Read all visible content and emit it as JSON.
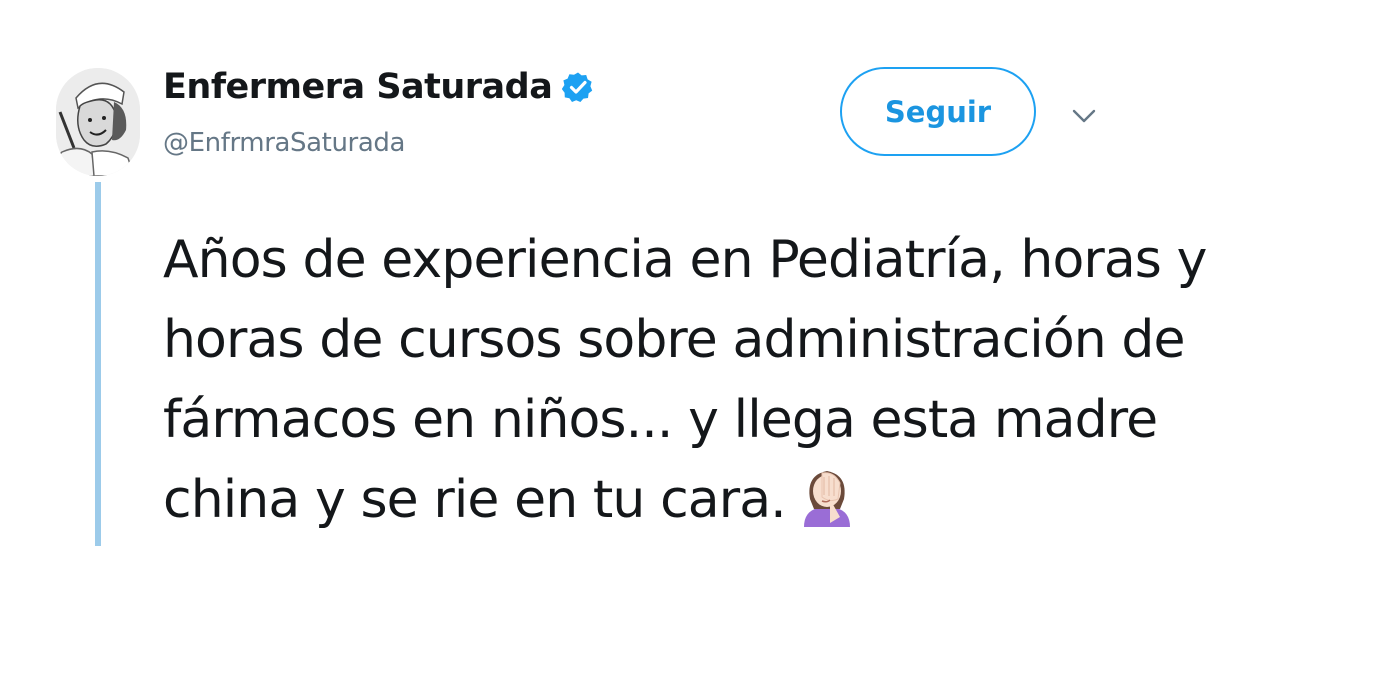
{
  "user": {
    "display_name": "Enfermera Saturada",
    "handle": "@EnfrmraSaturada",
    "verified": true,
    "avatar_icon": "nurse-avatar"
  },
  "follow_button": {
    "label": "Seguir"
  },
  "more_menu": {
    "icon": "chevron-down-icon"
  },
  "tweet": {
    "lines": [
      "Años de experiencia en Pediatría, horas y",
      "horas de cursos sobre administración de",
      "fármacos en niños... y llega esta madre",
      "china y se rie en tu cara."
    ],
    "emoji": "woman-facepalming"
  },
  "colors": {
    "accent": "#1da1f2",
    "accent_text": "#1b95e0",
    "thread_line": "#9ccbea",
    "text": "#14171a",
    "secondary_text": "#657786",
    "emoji_shirt": "#9a6dd6",
    "emoji_skin": "#f7dece"
  }
}
